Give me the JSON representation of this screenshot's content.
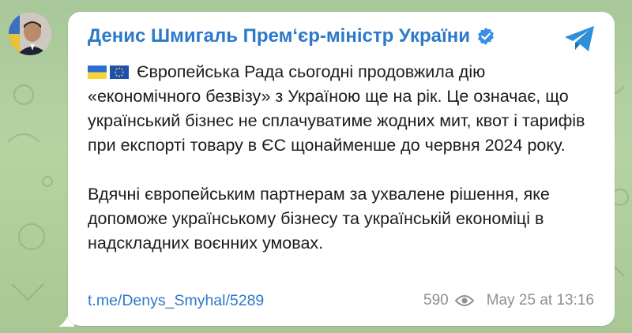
{
  "post": {
    "channel_name": "Денис Шмигаль Прем‘єр-міністр України",
    "paragraph_1": "Європейська Рада сьогодні продовжила дію «економічного безвізу» з Україною ще на рік. Це означає, що український бізнес не сплачуватиме жодних мит, квот і тарифів при експорті товару в ЄС щонайменше до червня 2024 року.",
    "paragraph_2": "Вдячні європейським партнерам за ухвалене рішення, яке допоможе українському бізнесу та українській економіці в надскладних воєнних умовах.",
    "link": "t.me/Denys_Smyhal/5289",
    "views": "590",
    "timestamp": "May 25 at 13:16"
  },
  "icons": {
    "verified": "verified-badge-icon",
    "share": "share-arrow-icon",
    "views": "eye-icon",
    "flags": [
      "ukraine-flag-icon",
      "eu-flag-icon"
    ]
  },
  "colors": {
    "accent": "#2c79c9",
    "meta": "#8e8e93",
    "background": "#b6d3a2"
  }
}
